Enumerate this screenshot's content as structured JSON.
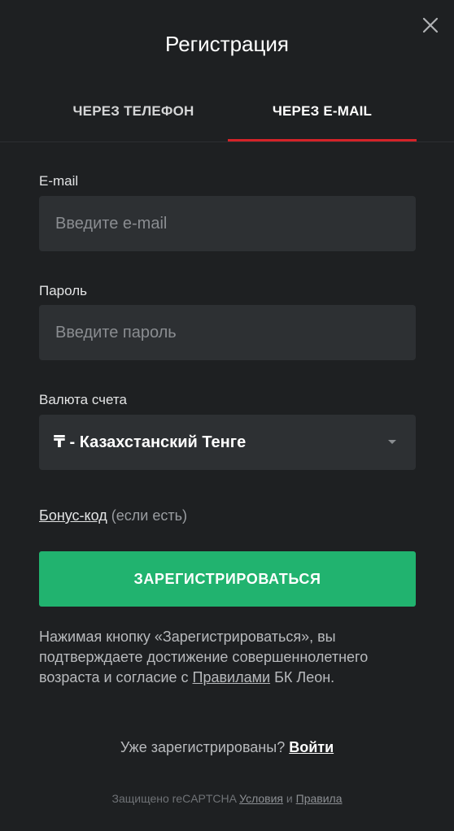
{
  "modal": {
    "title": "Регистрация",
    "close_icon": "close-icon"
  },
  "tabs": [
    {
      "label": "ЧЕРЕЗ ТЕЛЕФОН",
      "active": false
    },
    {
      "label": "ЧЕРЕЗ E-MAIL",
      "active": true
    }
  ],
  "colors": {
    "background": "#1e2022",
    "input_background": "#2d3033",
    "active_tab_accent": "#d52328",
    "submit_button": "#21b36f"
  },
  "form": {
    "email": {
      "label": "E-mail",
      "value": "",
      "placeholder": "Введите e-mail"
    },
    "password": {
      "label": "Пароль",
      "value": "",
      "placeholder": "Введите пароль"
    },
    "currency": {
      "label": "Валюта счета",
      "selected": "₸ - Казахстанский Тенге",
      "icon": "chevron-down-icon"
    },
    "bonus": {
      "link": "Бонус-код",
      "note": "(если есть)"
    },
    "submit_label": "ЗАРЕГИСТРИРОВАТЬСЯ"
  },
  "disclaimer": {
    "text": "Нажимая кнопку «Зарегистрироваться», вы подтверждаете достижение совершеннолетнего возраста и согласие с",
    "link": "Правилами",
    "suffix": "БК Леон."
  },
  "login": {
    "prompt": "Уже зарегистрированы?",
    "link": "Войти"
  },
  "recaptcha": {
    "text": "Защищено reCAPTCHA",
    "terms_link": "Условия",
    "and": "и",
    "privacy_link": "Правила"
  }
}
